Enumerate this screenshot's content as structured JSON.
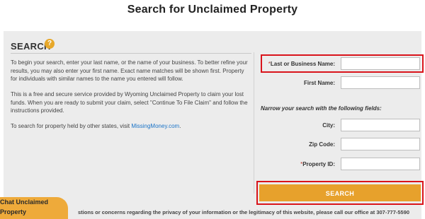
{
  "page": {
    "title": "Search for Unclaimed Property"
  },
  "search_section": {
    "heading": "SEARCH",
    "help_icon": "question-icon",
    "help_glyph": "?",
    "paragraph1": "To begin your search, enter your last name, or the name of your business. To better refine your results, you may also enter your first name. Exact name matches will be shown first. Property for individuals with similar names to the name you entered will follow.",
    "paragraph2": "This is a free and secure service provided by Wyoming Unclaimed Property to claim your lost funds. When you are ready to submit your claim, select \"Continue To File Claim\" and follow the instructions provided.",
    "paragraph3_prefix": "To search for property held by other states, visit ",
    "paragraph3_link": "MissingMoney.com",
    "paragraph3_suffix": "."
  },
  "form": {
    "required_marker": "*",
    "last_name_label": "Last or Business Name:",
    "last_name_value": "",
    "first_name_label": "First Name:",
    "first_name_value": "",
    "narrow_text": "Narrow your search with the following fields:",
    "city_label": "City:",
    "city_value": "",
    "zip_label": "Zip Code:",
    "zip_value": "",
    "property_id_label": "Property ID:",
    "property_id_value": "",
    "search_button": "SEARCH"
  },
  "footer": {
    "note": "stions or concerns regarding the privacy of your information or the legitimacy of this website, please call our office at 307-777-5590"
  },
  "chat": {
    "label": "Chat Unclaimed Property"
  },
  "colors": {
    "accent": "#e7a12c",
    "highlight_box": "#d9141b",
    "link": "#1a73c7",
    "panel": "#ececec"
  }
}
